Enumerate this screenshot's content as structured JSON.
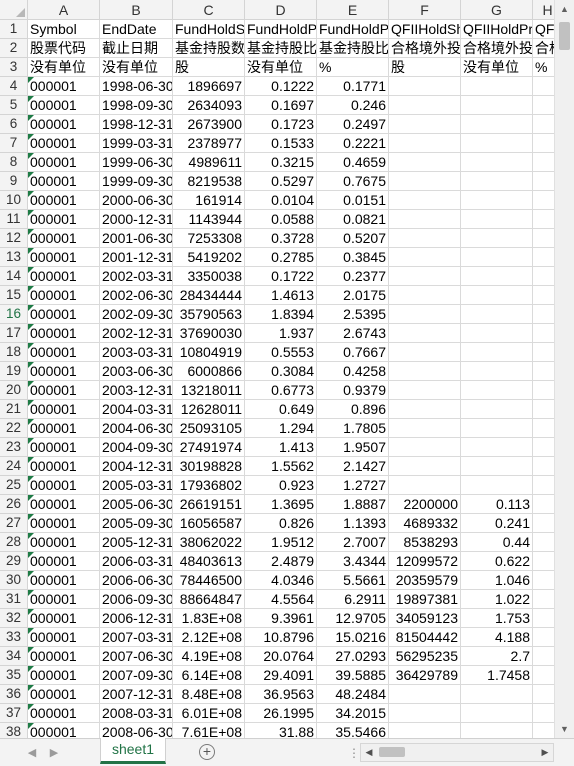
{
  "columns": [
    "A",
    "B",
    "C",
    "D",
    "E",
    "F",
    "G",
    "H"
  ],
  "row_numbers": [
    1,
    2,
    3,
    4,
    5,
    6,
    7,
    8,
    9,
    10,
    11,
    12,
    13,
    14,
    15,
    16,
    17,
    18,
    19,
    20,
    21,
    22,
    23,
    24,
    25,
    26,
    27,
    28,
    29,
    30,
    31,
    32,
    33,
    34,
    35,
    36,
    37,
    38
  ],
  "selected_row": 16,
  "header_rows": [
    [
      "Symbol",
      "EndDate",
      "FundHoldShares",
      "FundHoldProportion",
      "FundHoldProportionOfTradable",
      "QFIIHoldShares",
      "QFIIHoldProportion",
      "QF"
    ],
    [
      "股票代码",
      "截止日期",
      "基金持股数",
      "基金持股比例",
      "基金持股比例",
      "合格境外投",
      "合格境外投",
      "合格"
    ],
    [
      "没有单位",
      "没有单位",
      "股",
      "没有单位",
      "%",
      "股",
      "没有单位",
      "%"
    ]
  ],
  "rows": [
    [
      "000001",
      "1998-06-30",
      "1896697",
      "0.1222",
      "0.1771",
      "",
      "",
      ""
    ],
    [
      "000001",
      "1998-09-30",
      "2634093",
      "0.1697",
      "0.246",
      "",
      "",
      ""
    ],
    [
      "000001",
      "1998-12-31",
      "2673900",
      "0.1723",
      "0.2497",
      "",
      "",
      ""
    ],
    [
      "000001",
      "1999-03-31",
      "2378977",
      "0.1533",
      "0.2221",
      "",
      "",
      ""
    ],
    [
      "000001",
      "1999-06-30",
      "4989611",
      "0.3215",
      "0.4659",
      "",
      "",
      ""
    ],
    [
      "000001",
      "1999-09-30",
      "8219538",
      "0.5297",
      "0.7675",
      "",
      "",
      ""
    ],
    [
      "000001",
      "2000-06-30",
      "161914",
      "0.0104",
      "0.0151",
      "",
      "",
      ""
    ],
    [
      "000001",
      "2000-12-31",
      "1143944",
      "0.0588",
      "0.0821",
      "",
      "",
      ""
    ],
    [
      "000001",
      "2001-06-30",
      "7253308",
      "0.3728",
      "0.5207",
      "",
      "",
      ""
    ],
    [
      "000001",
      "2001-12-31",
      "5419202",
      "0.2785",
      "0.3845",
      "",
      "",
      ""
    ],
    [
      "000001",
      "2002-03-31",
      "3350038",
      "0.1722",
      "0.2377",
      "",
      "",
      ""
    ],
    [
      "000001",
      "2002-06-30",
      "28434444",
      "1.4613",
      "2.0175",
      "",
      "",
      ""
    ],
    [
      "000001",
      "2002-09-30",
      "35790563",
      "1.8394",
      "2.5395",
      "",
      "",
      ""
    ],
    [
      "000001",
      "2002-12-31",
      "37690030",
      "1.937",
      "2.6743",
      "",
      "",
      ""
    ],
    [
      "000001",
      "2003-03-31",
      "10804919",
      "0.5553",
      "0.7667",
      "",
      "",
      ""
    ],
    [
      "000001",
      "2003-06-30",
      "6000866",
      "0.3084",
      "0.4258",
      "",
      "",
      ""
    ],
    [
      "000001",
      "2003-12-31",
      "13218011",
      "0.6773",
      "0.9379",
      "",
      "",
      ""
    ],
    [
      "000001",
      "2004-03-31",
      "12628011",
      "0.649",
      "0.896",
      "",
      "",
      ""
    ],
    [
      "000001",
      "2004-06-30",
      "25093105",
      "1.294",
      "1.7805",
      "",
      "",
      ""
    ],
    [
      "000001",
      "2004-09-30",
      "27491974",
      "1.413",
      "1.9507",
      "",
      "",
      ""
    ],
    [
      "000001",
      "2004-12-31",
      "30198828",
      "1.5562",
      "2.1427",
      "",
      "",
      ""
    ],
    [
      "000001",
      "2005-03-31",
      "17936802",
      "0.923",
      "1.2727",
      "",
      "",
      ""
    ],
    [
      "000001",
      "2005-06-30",
      "26619151",
      "1.3695",
      "1.8887",
      "2200000",
      "0.113",
      ""
    ],
    [
      "000001",
      "2005-09-30",
      "16056587",
      "0.826",
      "1.1393",
      "4689332",
      "0.241",
      ""
    ],
    [
      "000001",
      "2005-12-31",
      "38062022",
      "1.9512",
      "2.7007",
      "8538293",
      "0.44",
      ""
    ],
    [
      "000001",
      "2006-03-31",
      "48403613",
      "2.4879",
      "3.4344",
      "12099572",
      "0.622",
      ""
    ],
    [
      "000001",
      "2006-06-30",
      "78446500",
      "4.0346",
      "5.5661",
      "20359579",
      "1.046",
      ""
    ],
    [
      "000001",
      "2006-09-30",
      "88664847",
      "4.5564",
      "6.2911",
      "19897381",
      "1.022",
      ""
    ],
    [
      "000001",
      "2006-12-31",
      "1.83E+08",
      "9.3961",
      "12.9705",
      "34059123",
      "1.753",
      ""
    ],
    [
      "000001",
      "2007-03-31",
      "2.12E+08",
      "10.8796",
      "15.0216",
      "81504442",
      "4.188",
      ""
    ],
    [
      "000001",
      "2007-06-30",
      "4.19E+08",
      "20.0764",
      "27.0293",
      "56295235",
      "2.7",
      ""
    ],
    [
      "000001",
      "2007-09-30",
      "6.14E+08",
      "29.4091",
      "39.5885",
      "36429789",
      "1.7458",
      ""
    ],
    [
      "000001",
      "2007-12-31",
      "8.48E+08",
      "36.9563",
      "48.2484",
      "",
      "",
      ""
    ],
    [
      "000001",
      "2008-03-31",
      "6.01E+08",
      "26.1995",
      "34.2015",
      "",
      "",
      ""
    ],
    [
      "000001",
      "2008-06-30",
      "7.61E+08",
      "31.88",
      "35.5466",
      "",
      "",
      ""
    ]
  ],
  "sheet_tab": "sheet1",
  "icons": {
    "add_sheet": "plus-circle-icon",
    "nav_prev": "triangle-left-icon",
    "nav_next": "triangle-right-icon",
    "scroll_up": "triangle-up-icon",
    "scroll_down": "triangle-down-icon"
  },
  "colors": {
    "accent": "#217346",
    "error_triangle": "#1e7b45",
    "header_bg": "#f3f3f3",
    "gridline": "#dadada"
  }
}
